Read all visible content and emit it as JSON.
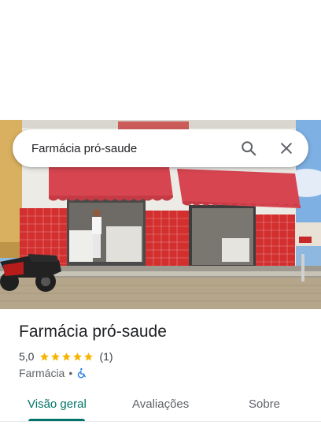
{
  "search": {
    "value": "Farmácia pró-saude",
    "search_icon": "search-icon",
    "close_icon": "close-icon"
  },
  "place": {
    "name": "Farmácia pró-saude",
    "rating": "5,0",
    "stars": 5,
    "review_count": "(1)",
    "category": "Farmácia",
    "separator": "•",
    "accessibility_icon": "wheelchair-icon"
  },
  "tabs": [
    {
      "label": "Visão geral",
      "active": true
    },
    {
      "label": "Avaliações",
      "active": false
    },
    {
      "label": "Sobre",
      "active": false
    }
  ],
  "colors": {
    "accent": "#00756a",
    "star": "#f4b400",
    "accessibility": "#1a73e8"
  }
}
